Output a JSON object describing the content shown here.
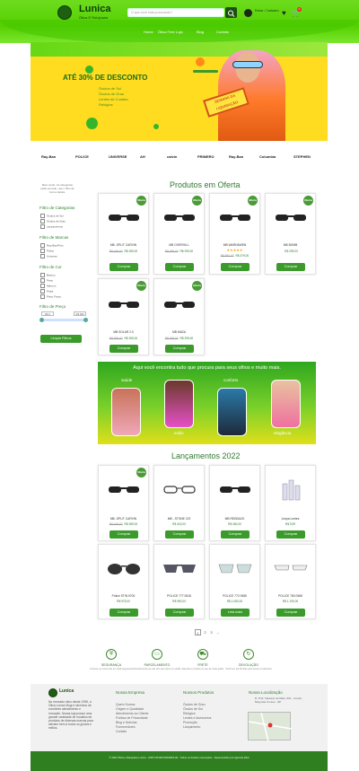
{
  "header": {
    "brand_name": "Lunica",
    "brand_sub": "Ótica E Relojoaria",
    "search_placeholder": "O que você está procurando?",
    "account_label": "Entrar / Cadastro",
    "cart_count": "0"
  },
  "nav": [
    "Home",
    "Ótica Free",
    "Loja",
    "Blog",
    "Contato"
  ],
  "hero": {
    "headline": "ATÉ 30% DE DESCONTO",
    "lines": [
      "Óculos de Sol",
      "Óculos de Grau",
      "Lentes de Contato",
      "Relógios"
    ],
    "sign": "SEMANA DA LIQUIDAÇÃO"
  },
  "brands": [
    "Ray-Ban",
    "POLICE",
    "UNIVERSE",
    "AH",
    "calvin",
    "PRIMERO",
    "Ray-Ban",
    "Columbia",
    "STEPHEN"
  ],
  "sidebar": {
    "note": "Bem-vindo. As categorias estão ao lado, use o filtro de forma rápida.",
    "cat_title": "Filtro de Categorias",
    "categories": [
      "Óculos de Sol",
      "Óculos de Grau",
      "Lançamentos"
    ],
    "brand_title": "Filtro de Marcas",
    "brands": [
      "Ray-Ban/Polo",
      "Police",
      "Universe"
    ],
    "color_title": "Filtro de Cor",
    "colors": [
      "Branco",
      "Preto",
      "Marrom",
      "Prata",
      "Preto Fosco"
    ],
    "price_title": "Filtro de Preço",
    "price_min": "R$ 0",
    "price_max": "R$ 999",
    "clear": "Limpar Filtros"
  },
  "offers": {
    "title": "Produtos em Oferta",
    "badge": "Oferta",
    "buy": "Comprar",
    "items": [
      {
        "name": "MB -SPLIT CARVIN",
        "old": "R$ 449,00",
        "price": "R$ 289,00"
      },
      {
        "name": "MB OVERHILL",
        "old": "R$ 399,00",
        "price": "R$ 299,00"
      },
      {
        "name": "MB WARHAWEN",
        "old": "R$ 850,00",
        "price": "R$ 479,00",
        "stars": "★★★★★"
      },
      {
        "name": "MB BOMB",
        "old": "",
        "price": "R$ 299,00"
      },
      {
        "name": "MB SOLAR 2.0",
        "old": "R$ 399,00",
        "price": "R$ 289,00"
      },
      {
        "name": "MB MAZA",
        "old": "R$ 399,00",
        "price": "R$ 299,00"
      }
    ]
  },
  "promo": {
    "title": "Aqui você encontra tudo que procura para seus olhos e muito mais.",
    "captions": [
      "saúde",
      "estilo",
      "conforto",
      "elegância"
    ]
  },
  "launches": {
    "title": "Lançamentos 2022",
    "badge": "Oferta",
    "buy": "Comprar",
    "more": "Leia mais",
    "items": [
      {
        "name": "MB -SPLIT CARVIN",
        "old": "R$ 449,00",
        "price": "R$ 289,00"
      },
      {
        "name": "MB - STONE CIS",
        "old": "",
        "price": "R$ 415,00"
      },
      {
        "name": "MB REDBACK",
        "old": "",
        "price": "R$ 450,00"
      },
      {
        "name": "Limpa Lentes",
        "old": "",
        "price": "R$ 5,99"
      },
      {
        "name": "Police STIN 5700",
        "old": "",
        "price": "R$ 975,00"
      },
      {
        "name": "POLICE 777 0818",
        "old": "",
        "price": "R$ 990,00"
      },
      {
        "name": "POLICE 772 0585",
        "old": "",
        "price": "R$ 1.080,00"
      },
      {
        "name": "POLICE 783 0568",
        "old": "",
        "price": "R$ 1.190,00"
      }
    ]
  },
  "pagination": [
    "1",
    "2",
    "3",
    "→"
  ],
  "features": [
    {
      "title": "SEGURANÇA",
      "desc": "Compre no nosso site em total segurança"
    },
    {
      "title": "PARCELAMENTO",
      "desc": "Parcelamento em até 10x sem juros no cartão"
    },
    {
      "title": "FRETE",
      "desc": "Receba o produto no seu lar, frete grátis"
    },
    {
      "title": "DEVOLUÇÃO",
      "desc": "Você tem até 30 dias para trocar ou devolver"
    }
  ],
  "footer": {
    "about": "No mercado ótico desde 1996, a Ótica Lunica Mogi é sinônimo de excelente atendimento e inovação. Nossa loja possui uma grande variedade de modelos de produtos de diversas marcas para atender bem a todos os gostos e estilos.",
    "company_title": "Nossa Empresa",
    "company": [
      "Quem Somos",
      "Origem e Qualidade",
      "Atendimento ao Cliente",
      "Política de Privacidade",
      "Blog e Notícias",
      "Fornecedores",
      "Contato"
    ],
    "products_title": "Nossos Produtos",
    "products": [
      "Óculos de Grau",
      "Óculos de Sol",
      "Relógios",
      "Lentes e Acessórios",
      "Promoção",
      "Lançamento"
    ],
    "location_title": "Nossa Localização",
    "address": "R. Prof. Flaviano de Melo, 501 - Centro, Mogi das Cruzes - SP",
    "copyright": "© 2022 Ótica e Relojoaria Lunica - CNPJ 00.000.000/0001-00 - Todos os direitos reservados - Desenvolvido por Agência Web"
  }
}
